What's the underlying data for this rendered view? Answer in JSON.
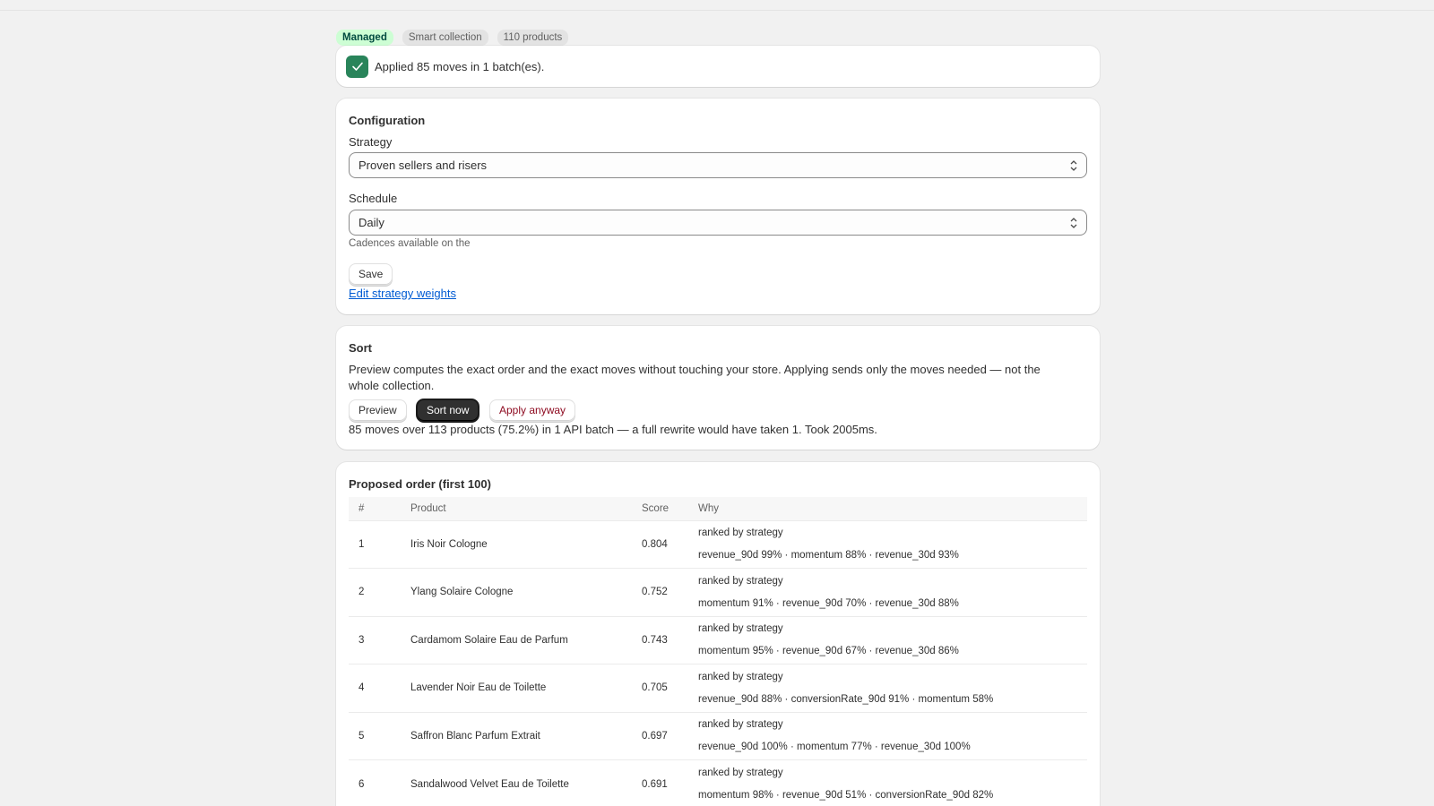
{
  "badges": {
    "status": "Managed",
    "type": "Smart collection",
    "count": "110 products"
  },
  "banner": {
    "message": "Applied 85 moves in 1 batch(es)."
  },
  "configuration": {
    "title": "Configuration",
    "strategy_label": "Strategy",
    "strategy_value": "Proven sellers and risers",
    "schedule_label": "Schedule",
    "schedule_value": "Daily",
    "schedule_help": "Cadences available on the",
    "save_label": "Save",
    "edit_weights_label": "Edit strategy weights"
  },
  "sort": {
    "title": "Sort",
    "description_line1": "Preview computes the exact order and the exact moves without touching your store. Applying sends only the moves needed — not the",
    "description_line2": "whole collection.",
    "preview_label": "Preview",
    "sort_now_label": "Sort now",
    "apply_anyway_label": "Apply anyway",
    "result": "85 moves over 113 products (75.2%) in 1 API batch — a full rewrite would have taken 1. Took 2005ms."
  },
  "proposed": {
    "title": "Proposed order (first 100)",
    "columns": [
      "#",
      "Product",
      "Score",
      "Why"
    ],
    "rows": [
      {
        "rank": "1",
        "product": "Iris Noir Cologne",
        "score": "0.804",
        "why": "ranked by strategy",
        "detail": "revenue_90d 99% · momentum 88% · revenue_30d 93%"
      },
      {
        "rank": "2",
        "product": "Ylang Solaire Cologne",
        "score": "0.752",
        "why": "ranked by strategy",
        "detail": "momentum 91% · revenue_90d 70% · revenue_30d 88%"
      },
      {
        "rank": "3",
        "product": "Cardamom Solaire Eau de Parfum",
        "score": "0.743",
        "why": "ranked by strategy",
        "detail": "momentum 95% · revenue_90d 67% · revenue_30d 86%"
      },
      {
        "rank": "4",
        "product": "Lavender Noir Eau de Toilette",
        "score": "0.705",
        "why": "ranked by strategy",
        "detail": "revenue_90d 88% · conversionRate_90d 91% · momentum 58%"
      },
      {
        "rank": "5",
        "product": "Saffron Blanc Parfum Extrait",
        "score": "0.697",
        "why": "ranked by strategy",
        "detail": "revenue_90d 100% · momentum 77% · revenue_30d 100%"
      },
      {
        "rank": "6",
        "product": "Sandalwood Velvet Eau de Toilette",
        "score": "0.691",
        "why": "ranked by strategy",
        "detail": "momentum 98% · revenue_90d 51% · conversionRate_90d 82%"
      }
    ]
  },
  "colors": {
    "success_badge_bg": "#cdfed4",
    "success_icon_bg": "#29845a",
    "primary_button": "#303030",
    "critical_text": "#8e0b21",
    "link": "#005bd3"
  }
}
